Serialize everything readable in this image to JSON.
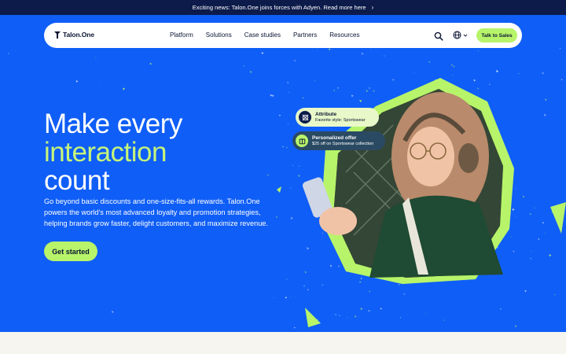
{
  "announcement": {
    "text": "Exciting news: Talon.One joins forces with Adyen. Read more here"
  },
  "nav": {
    "logo": "Talon.One",
    "links": [
      "Platform",
      "Solutions",
      "Case studies",
      "Partners",
      "Resources"
    ],
    "cta": "Talk to Sales"
  },
  "hero": {
    "headline_line1": "Make every",
    "headline_accent": "interaction",
    "headline_line3": "count",
    "subtext": "Go beyond basic discounts and one-size-fits-all rewards. Talon.One powers the world's most advanced loyalty and promotion strategies, helping brands grow faster, delight customers, and maximize revenue.",
    "cta": "Get started"
  },
  "cards": {
    "attribute": {
      "title": "Attribute",
      "detail": "Favorite style: Sportswear"
    },
    "offer": {
      "title": "Personalized offer",
      "detail": "$25 off on Sportswear collection"
    }
  },
  "colors": {
    "hero_bg": "#0f5ef7",
    "accent_green": "#b7f46a",
    "announce_bg": "#0c1b4a"
  }
}
